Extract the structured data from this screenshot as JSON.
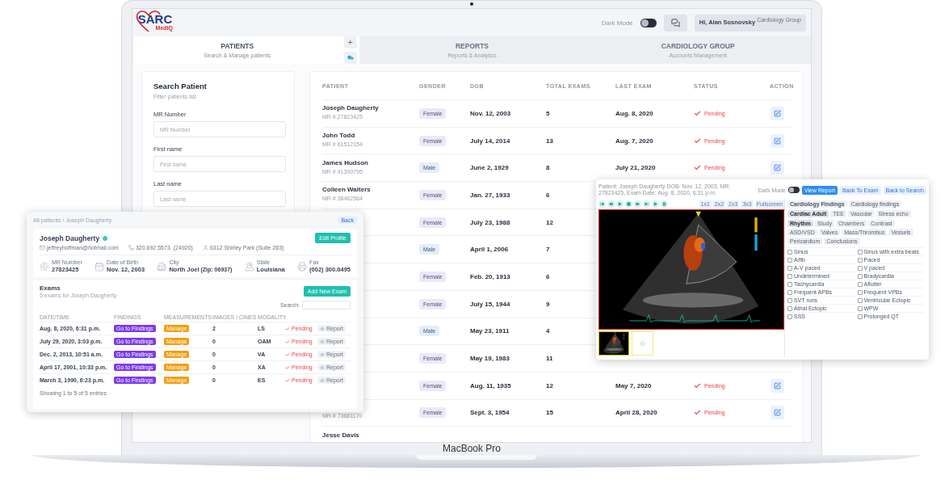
{
  "header": {
    "logo": {
      "title": "SARC",
      "subtitle": "MediQ"
    },
    "dark_mode": {
      "label": "Dark Mode",
      "on": false
    },
    "user": {
      "greeting": "Hi, Alan Sosnovsky",
      "group": "Cardiology Group"
    }
  },
  "tabs": [
    {
      "title": "PATIENTS",
      "subtitle": "Search & Manage patients",
      "selected": true
    },
    {
      "title": "REPORTS",
      "subtitle": "Reports & Analytics",
      "selected": false
    },
    {
      "title": "CARDIOLOGY GROUP",
      "subtitle": "Accounts Management",
      "selected": false
    }
  ],
  "tab_actions": {
    "add": "+"
  },
  "search_panel": {
    "title": "Search Patient",
    "subtitle": "Filter patients list",
    "fields": [
      {
        "label": "MR Number",
        "placeholder": "MR Number"
      },
      {
        "label": "First name",
        "placeholder": "First name"
      },
      {
        "label": "Last name",
        "placeholder": "Last name"
      }
    ]
  },
  "table": {
    "columns": [
      "PATIENT",
      "GENDER",
      "DOB",
      "TOTAL EXAMS",
      "LAST EXAM",
      "STATUS",
      "ACTION"
    ],
    "rows": [
      {
        "name": "Joseph Daugherty",
        "mr": "MR # 27823425",
        "gender": {
          "label": "Female",
          "kind": "female"
        },
        "dob": "Nov. 12, 2003",
        "total": "5",
        "last_exam": "Aug. 8, 2020",
        "status": "Pending",
        "action": {
          "kind": "edit"
        }
      },
      {
        "name": "John Todd",
        "mr": "MR # 61512154",
        "gender": {
          "label": "Female",
          "kind": "female"
        },
        "dob": "July 14, 2014",
        "total": "13",
        "last_exam": "Aug. 7, 2020",
        "status": "Pending",
        "action": {
          "kind": "edit"
        }
      },
      {
        "name": "James Hudson",
        "mr": "MR # 41399795",
        "gender": {
          "label": "Male",
          "kind": "male"
        },
        "dob": "June 2, 1929",
        "total": "8",
        "last_exam": "July 21, 2020",
        "status": "Pending",
        "action": {
          "kind": "edit"
        }
      },
      {
        "name": "Colleen Walters",
        "mr": "MR # 38462584",
        "gender": {
          "label": "Female",
          "kind": "female"
        },
        "dob": "Jan. 27, 1933",
        "total": "6"
      },
      {
        "gender": {
          "label": "Female",
          "kind": "female"
        },
        "dob": "July 23, 1988",
        "total": "12"
      },
      {
        "gender": {
          "label": "Male",
          "kind": "male"
        },
        "dob": "April 1, 2006",
        "total": "7"
      },
      {
        "gender": {
          "label": "Female",
          "kind": "female"
        },
        "dob": "Feb. 20, 1913",
        "total": "6"
      },
      {
        "gender": {
          "label": "Female",
          "kind": "female"
        },
        "dob": "July 15, 1944",
        "total": "9"
      },
      {
        "gender": {
          "label": "Male",
          "kind": "male"
        },
        "dob": "May 23, 1911",
        "total": "4"
      },
      {
        "gender": {
          "label": "Female",
          "kind": "female"
        },
        "dob": "May 19, 1983",
        "total": "11"
      },
      {
        "gender": {
          "label": "Female",
          "kind": "female"
        },
        "dob": "Aug. 11, 1935",
        "total": "12",
        "last_exam": "May 7, 2020",
        "status": "Pending",
        "action": {
          "kind": "edit"
        }
      },
      {
        "mr": "MR # 73681170",
        "gender": {
          "label": "Female",
          "kind": "female"
        },
        "dob": "Sept. 3, 1954",
        "total": "15",
        "last_exam": "April 28, 2020",
        "status": "Pending",
        "action": {
          "kind": "edit"
        }
      },
      {
        "name": "Jesse Davis"
      }
    ]
  },
  "patient_card": {
    "breadcrumb": "All patients › Joseph Daugherty",
    "back": "Back",
    "name": "Joseph Daugherty",
    "edit": "Edit Profile",
    "contacts": [
      {
        "kind": "email",
        "text": "jeffreyhoffman@hotmail.com"
      },
      {
        "kind": "phone",
        "text": "320.692.5573",
        "note": "(24920)"
      },
      {
        "kind": "address",
        "text": "6312 Shirley Park (Suite 283)"
      }
    ],
    "facts": [
      {
        "kind": "id",
        "label": "MR Number",
        "value": "27823425"
      },
      {
        "kind": "calendar",
        "label": "Date of Birth",
        "value": "Nov. 12, 2003"
      },
      {
        "kind": "city",
        "label": "City",
        "value": "North Joel",
        "note": "(Zip: 06937)"
      },
      {
        "kind": "state",
        "label": "State",
        "value": "Louisiana"
      },
      {
        "kind": "fax",
        "label": "Fax",
        "value": "(002) 300.0495"
      }
    ],
    "exams": {
      "title": "Exams",
      "subtitle": "5 exams for Joseph Daugherty",
      "add": "Add New Exam",
      "search_label": "Search:",
      "columns": [
        "DATE/TIME",
        "FINDINGS",
        "MEASUREMENTS",
        "IMAGES / CINES",
        "MODALITY"
      ],
      "rows": [
        {
          "date": "Aug. 8, 2020, 6:31 p.m.",
          "findings": "Go to Findings",
          "measurements": "Manage",
          "images": "2",
          "modality": "LS",
          "status": "Pending",
          "report": "Report"
        },
        {
          "date": "July 29, 2020, 3:03 p.m.",
          "findings": "Go to Findings",
          "measurements": "Manage",
          "images": "0",
          "modality": "OAM",
          "status": "Pending",
          "report": "Report"
        },
        {
          "date": "Dec. 2, 2013, 10:51 a.m.",
          "findings": "Go to Findings",
          "measurements": "Manage",
          "images": "0",
          "modality": "VA",
          "status": "Pending",
          "report": "Report"
        },
        {
          "date": "April 17, 2001, 10:33 p.m.",
          "findings": "Go to Findings",
          "measurements": "Manage",
          "images": "0",
          "modality": "XA",
          "status": "Pending",
          "report": "Report"
        },
        {
          "date": "March 3, 1990, 6:23 p.m.",
          "findings": "Go to Findings",
          "measurements": "Manage",
          "images": "0",
          "modality": "ES",
          "status": "Pending",
          "report": "Report"
        }
      ],
      "footer": "Showing 1 to 5 of 5 entries"
    }
  },
  "viewer": {
    "info": "Patient: Joseph Daugherty DOB: Nov. 12, 2003, MR: 27823425, Exam Date: Aug. 8, 2020, 6:31 p.m.",
    "dark_mode": {
      "label": "Dark Mode",
      "on": false
    },
    "buttons": [
      {
        "label": "View Report",
        "primary": true
      },
      {
        "label": "Back To Exam",
        "primary": false
      },
      {
        "label": "Back to Search",
        "primary": false
      }
    ],
    "layouts": [
      "1x1",
      "2x2",
      "2x3",
      "3x3",
      "Fullscreen"
    ],
    "thumbnails": [
      {
        "kind": "picture",
        "selected": true
      },
      {
        "kind": "loading",
        "selected": false
      }
    ],
    "findings_title": "Cardiology Findings",
    "findings_subtitle": "Cardiology findings",
    "categories": [
      {
        "label": "Cardiac Adult",
        "selected": true
      },
      {
        "label": "TEE",
        "selected": false
      },
      {
        "label": "Vascular",
        "selected": false
      },
      {
        "label": "Stress echo",
        "selected": false
      }
    ],
    "sections": [
      {
        "label": "Rhythm",
        "selected": true
      },
      {
        "label": "Study",
        "selected": false
      },
      {
        "label": "Chambers",
        "selected": false
      },
      {
        "label": "Contrast",
        "selected": false
      },
      {
        "label": "ASD/VSD",
        "selected": false
      },
      {
        "label": "Valves",
        "selected": false
      },
      {
        "label": "Mass/Thrombus",
        "selected": false
      },
      {
        "label": "Vessels",
        "selected": false
      },
      {
        "label": "Pericardium",
        "selected": false
      },
      {
        "label": "Conclusions",
        "selected": false
      }
    ],
    "options": [
      {
        "label": "Sinus",
        "checked": false
      },
      {
        "label": "Sinus with extra beats",
        "checked": false
      },
      {
        "label": "A/fib",
        "checked": false
      },
      {
        "label": "Paced",
        "checked": false
      },
      {
        "label": "A-V paced",
        "checked": false
      },
      {
        "label": "V paced",
        "checked": false
      },
      {
        "label": "Undetermined",
        "checked": false
      },
      {
        "label": "Bradycardia",
        "checked": false
      },
      {
        "label": "Tachycardia",
        "checked": false
      },
      {
        "label": "Aflutter",
        "checked": false
      },
      {
        "label": "Frequent APBs",
        "checked": false
      },
      {
        "label": "Frequent VPBs",
        "checked": false
      },
      {
        "label": "SVT runs",
        "checked": false
      },
      {
        "label": "Ventricular Ectopic",
        "checked": false
      },
      {
        "label": "Atrial Ectopic",
        "checked": false
      },
      {
        "label": "WPW",
        "checked": false
      },
      {
        "label": "SSS",
        "checked": false
      },
      {
        "label": "Prolonged QT",
        "checked": false
      }
    ]
  },
  "laptop": {
    "label": "MacBook Pro"
  }
}
